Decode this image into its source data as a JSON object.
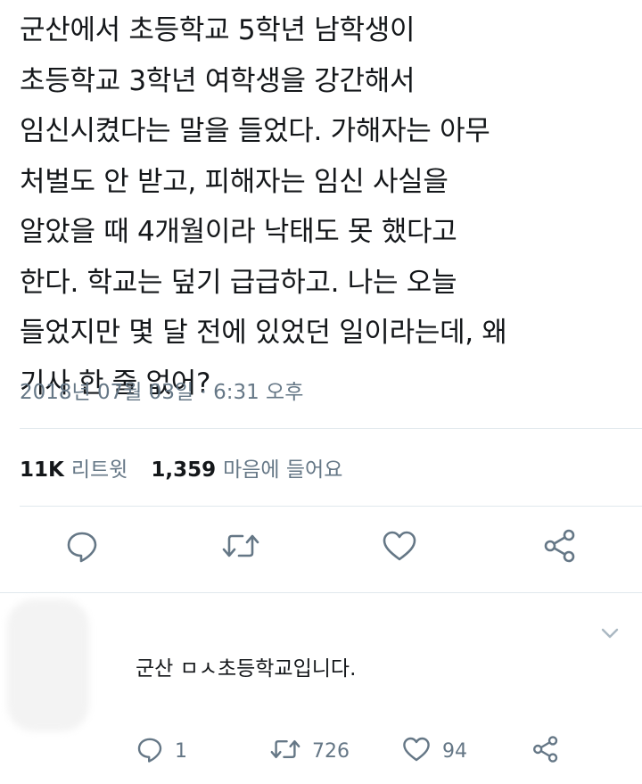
{
  "tweet": {
    "text": "군산에서 초등학교 5학년 남학생이\n초등학교 3학년 여학생을 강간해서\n임신시켰다는 말을 들었다. 가해자는 아무\n처벌도 안 받고, 피해자는 임신 사실을\n알았을 때 4개월이라 낙태도 못 했다고\n한다. 학교는 덮기 급급하고. 나는 오늘\n들었지만 몇 달 전에 있었던 일이라는데, 왜\n기사 한 줄 없어?",
    "timestamp": "2018년 07월 03일 · 6:31 오후"
  },
  "stats": {
    "retweets_count": "11K",
    "retweets_label": "리트윗",
    "likes_count": "1,359",
    "likes_label": "마음에 들어요"
  },
  "reply": {
    "text": "군산 ㅁㅅ초등학교입니다.",
    "reply_count": "1",
    "retweet_count": "726",
    "like_count": "94"
  },
  "colors": {
    "text": "#14171a",
    "secondary": "#657786",
    "icon": "#657786",
    "divider": "#e1e8ed"
  },
  "icons": [
    "reply-icon",
    "retweet-icon",
    "like-icon",
    "share-icon",
    "chevron-down-icon"
  ]
}
